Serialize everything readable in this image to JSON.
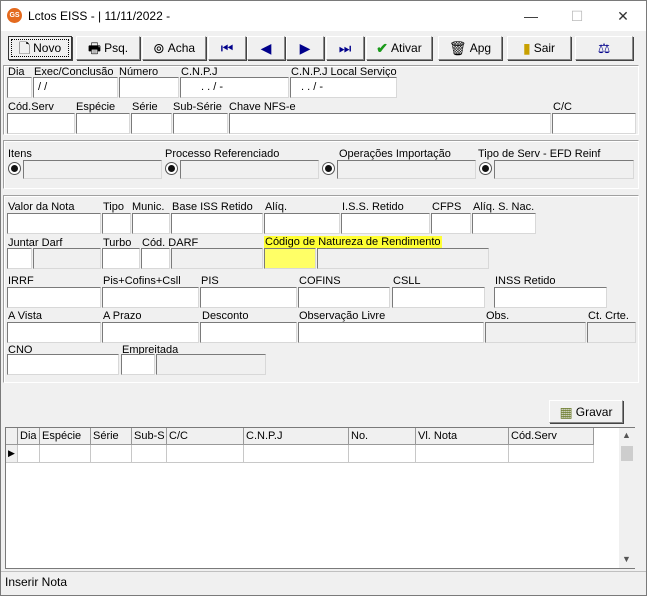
{
  "window": {
    "title": "Lctos EISS - | 11/11/2022 -",
    "app_icon_text": "GS",
    "minimize": "—",
    "maximize": "☐",
    "close": "✕"
  },
  "toolbar": {
    "novo": "Novo",
    "psq": "Psq.",
    "acha": "Acha",
    "ativar": "Ativar",
    "apg": "Apg",
    "sair": "Sair"
  },
  "header": {
    "dia_label": "Dia",
    "exec_label": "Exec/Conclusão",
    "numero_label": "Número",
    "cnpj_label": "C.N.P.J",
    "cnpj_local_label": "C.N.P.J Local Serviço",
    "exec_value": "/ /",
    "cnpj_value": ". . / -",
    "cnpj_local_value": ". . / -",
    "cod_serv_label": "Cód.Serv",
    "especie_label": "Espécie",
    "serie_label": "Série",
    "sub_serie_label": "Sub-Série",
    "chave_label": "Chave NFS-e",
    "cc_label": "C/C"
  },
  "refs": {
    "itens": "Itens",
    "processo": "Processo Referenciado",
    "operacoes": "Operações Importação",
    "tipo_serv": "Tipo de Serv - EFD Reinf"
  },
  "valores": {
    "valor_nota": "Valor da Nota",
    "tipo": "Tipo",
    "munic": "Munic.",
    "base_iss": "Base ISS Retido",
    "aliq": "Alíq.",
    "iss_retido": "I.S.S. Retido",
    "cfps": "CFPS",
    "aliq_snac": "Alíq. S. Nac.",
    "juntar_darf": "Juntar Darf",
    "turbo": "Turbo",
    "cod_darf": "Cód. DARF",
    "cod_natureza": "Código de Natureza de Rendimento",
    "irrf": "IRRF",
    "pis_cofins_csll": "Pis+Cofins+Csll",
    "pis": "PIS",
    "cofins": "COFINS",
    "csll": "CSLL",
    "inss_retido": "INSS Retido",
    "a_vista": "A Vista",
    "a_prazo": "A Prazo",
    "desconto": "Desconto",
    "obs_livre": "Observação Livre",
    "obs": "Obs.",
    "ct_crte": "Ct. Crte.",
    "cno": "CNO",
    "empreitada": "Empreitada"
  },
  "gravar": "Gravar",
  "grid": {
    "columns": [
      "Dia",
      "Espécie",
      "Série",
      "Sub-S",
      "C/C",
      "C.N.P.J",
      "No.",
      "Vl. Nota",
      "Cód.Serv"
    ]
  },
  "status": "Inserir Nota"
}
